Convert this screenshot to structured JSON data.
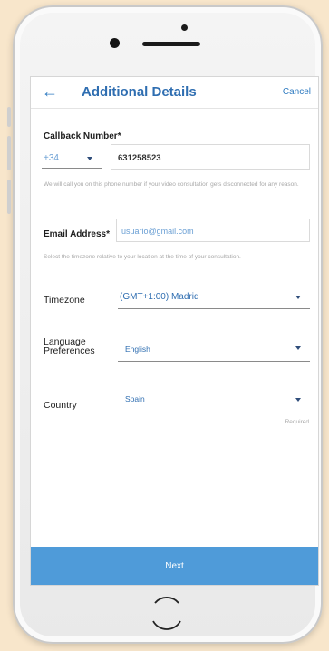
{
  "header": {
    "back_icon": "arrow-left-icon",
    "title": "Additional Details",
    "cancel_label": "Cancel"
  },
  "form": {
    "callback": {
      "label": "Callback Number*",
      "country_code": "+34",
      "phone": "631258523",
      "help": "We will call you on this phone number if your video consultation gets disconnected for any reason."
    },
    "email": {
      "label": "Email Address*",
      "value": "usuario@gmail.com",
      "help": "Select the timezone relative to your location at the time of your consultation."
    },
    "timezone": {
      "label": "Timezone",
      "value": "(GMT+1:00) Madrid"
    },
    "language": {
      "label_line1": "Language",
      "label_line2": "Preferences",
      "value": "English"
    },
    "country": {
      "label": "Country",
      "value": "Spain",
      "required_note": "Required"
    }
  },
  "footer": {
    "next_label": "Next"
  },
  "colors": {
    "accent": "#2f6eb1",
    "button": "#4f9bd9",
    "background": "#f8e6cb"
  }
}
